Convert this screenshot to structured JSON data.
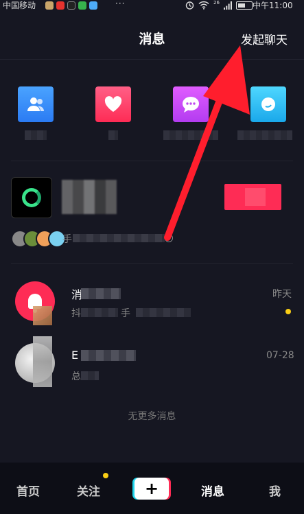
{
  "status_bar": {
    "carrier": "中国移动",
    "more": "···",
    "signal_label": "26",
    "time": "中午11:00"
  },
  "header": {
    "title": "消息",
    "start_chat": "发起聊天"
  },
  "featured": {
    "sub_text_prefix": "手",
    "info_icon": "i"
  },
  "messages": [
    {
      "name_prefix": "消",
      "preview_prefix": "抖",
      "preview_mid": "手",
      "time": "昨天",
      "unread": true
    },
    {
      "name_prefix": "E",
      "preview_prefix": "总",
      "time": "07-28",
      "unread": false
    }
  ],
  "footer": {
    "no_more": "无更多消息"
  },
  "nav": {
    "home": "首页",
    "following": "关注",
    "plus": "+",
    "messages": "消息",
    "me": "我"
  },
  "colors": {
    "background": "#161722",
    "accent_red": "#fe2c55",
    "accent_cyan": "#20d5ec",
    "unread_yellow": "#face15",
    "annotation_arrow": "#ff1e2d"
  },
  "icons": {
    "tile_1": "fans-icon",
    "tile_2": "heart-icon",
    "tile_3": "comment-icon",
    "tile_4": "at-mention-icon"
  }
}
